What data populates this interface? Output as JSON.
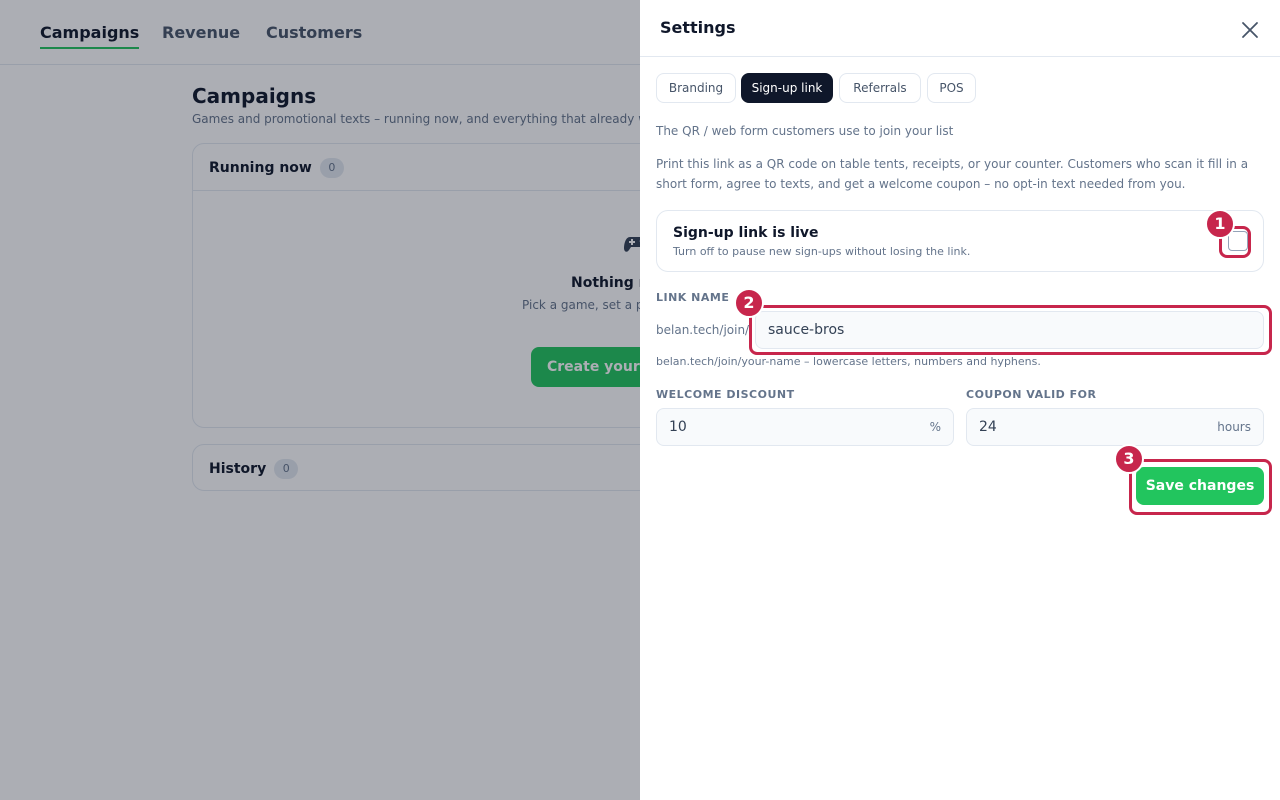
{
  "nav": {
    "tabs": [
      {
        "label": "Campaigns",
        "active": true
      },
      {
        "label": "Revenue",
        "active": false
      },
      {
        "label": "Customers",
        "active": false
      }
    ]
  },
  "background": {
    "title": "Campaigns",
    "subtitle": "Games and promotional texts – running now, and everything that already we",
    "running": {
      "label": "Running now",
      "count": "0",
      "empty_icon": "gamepad-icon",
      "empty_title": "Nothing ru",
      "empty_text": "Pick a game, set a prize, test it o takes it fr",
      "create_button": "Create your fi"
    },
    "history": {
      "label": "History",
      "count": "0"
    }
  },
  "drawer": {
    "title": "Settings",
    "close_icon": "close-icon",
    "tabs": [
      {
        "label": "Branding",
        "active": false
      },
      {
        "label": "Sign-up link",
        "active": true
      },
      {
        "label": "Referrals",
        "active": false
      },
      {
        "label": "POS",
        "active": false
      }
    ],
    "heading": "The QR / web form customers use to join your list",
    "description": "Print this link as a QR code on table tents, receipts, or your counter. Customers who scan it fill in a short form, agree to texts, and get a welcome coupon – no opt-in text needed from you.",
    "live_toggle": {
      "title": "Sign-up link is live",
      "help": "Turn off to pause new sign-ups without losing the link.",
      "checked": false
    },
    "link_name": {
      "label": "LINK NAME",
      "prefix": "belan.tech/join/",
      "value": "sauce-bros",
      "hint": "belan.tech/join/your-name – lowercase letters, numbers and hyphens."
    },
    "welcome_discount": {
      "label": "WELCOME DISCOUNT",
      "value": "10",
      "suffix": "%"
    },
    "coupon_valid": {
      "label": "COUPON VALID FOR",
      "value": "24",
      "suffix": "hours"
    },
    "save_button": "Save changes"
  },
  "annotations": {
    "markers": [
      "1",
      "2",
      "3"
    ],
    "color": "#c7264c"
  },
  "colors": {
    "accent": "#22c55e",
    "dark": "#0f172a",
    "annotation": "#c7264c"
  }
}
